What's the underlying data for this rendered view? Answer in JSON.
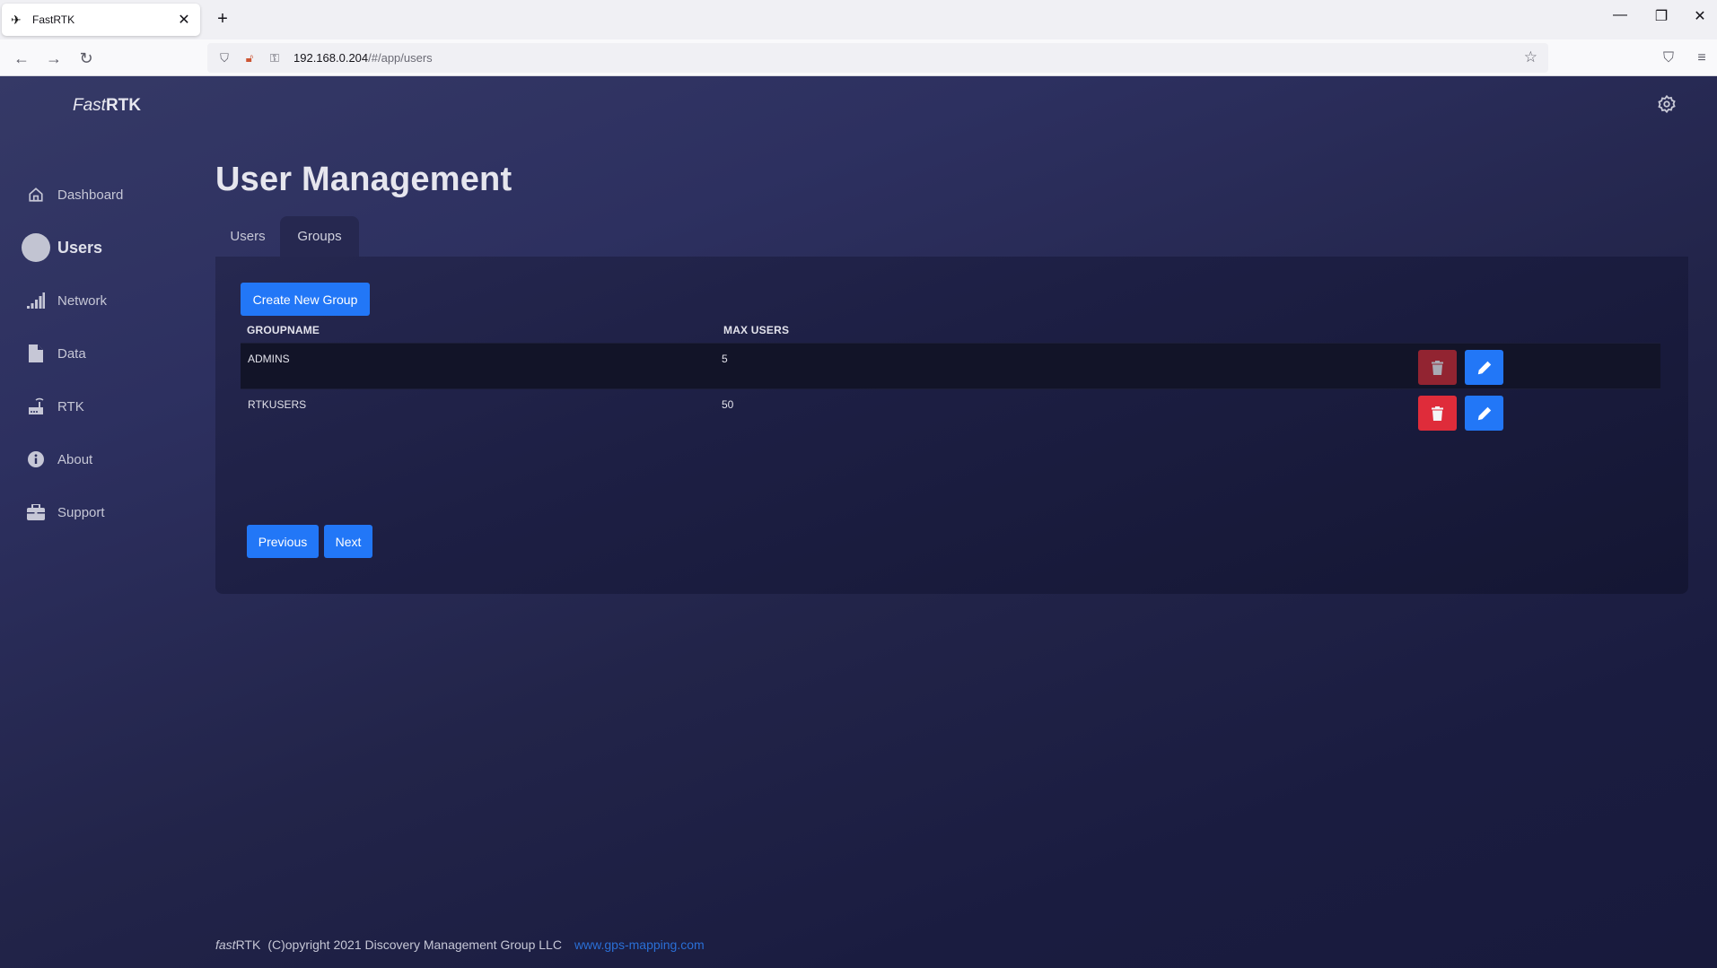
{
  "browser": {
    "tab_title": "FastRTK",
    "url_host": "192.168.0.204",
    "url_path": "/#/app/users"
  },
  "app": {
    "logo_italic": "Fast",
    "logo_bold": "RTK"
  },
  "sidebar": {
    "items": [
      {
        "label": "Dashboard",
        "icon": "home-icon"
      },
      {
        "label": "Users",
        "icon": "avatar-circle",
        "active": true
      },
      {
        "label": "Network",
        "icon": "signal-bars-icon"
      },
      {
        "label": "Data",
        "icon": "file-icon"
      },
      {
        "label": "RTK",
        "icon": "router-icon"
      },
      {
        "label": "About",
        "icon": "info-icon"
      },
      {
        "label": "Support",
        "icon": "briefcase-icon"
      }
    ]
  },
  "main": {
    "title": "User Management",
    "tabs": [
      {
        "label": "Users",
        "active": false
      },
      {
        "label": "Groups",
        "active": true
      }
    ],
    "create_button": "Create New Group",
    "table": {
      "columns": [
        "GROUPNAME",
        "MAX USERS"
      ],
      "rows": [
        {
          "groupname": "ADMINS",
          "max_users": "5",
          "delete_disabled": true
        },
        {
          "groupname": "RTKUSERS",
          "max_users": "50",
          "delete_disabled": false
        }
      ]
    },
    "pagination": {
      "previous": "Previous",
      "next": "Next"
    }
  },
  "footer": {
    "brand_italic": "fast",
    "brand_rest": "RTK",
    "copyright": "(C)opyright 2021 Discovery Management Group LLC",
    "link": "www.gps-mapping.com"
  },
  "colors": {
    "primary": "#2277f7",
    "danger": "#df2c3a",
    "danger_disabled": "#922431",
    "link": "#2a6fd6"
  }
}
